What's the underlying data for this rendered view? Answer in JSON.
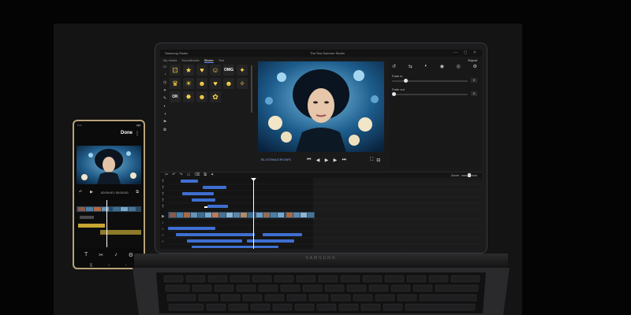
{
  "phone": {
    "status_time": "9:41",
    "status_icons": "▮▮▮",
    "done_label": "Done",
    "more_icon": "⋮",
    "play_icon": "▶",
    "timecode": "00:00:00 / 00:00:00",
    "undo_icon": "↶",
    "compare_icon": "⧉",
    "tabbar": [
      "T",
      "✂",
      "♪",
      "⚙"
    ],
    "navbar": [
      "|||",
      "○",
      "‹"
    ]
  },
  "laptop": {
    "app_title": "Samsung Studio",
    "project_title": "The Sea Summer Studio",
    "window_buttons": "— ▢ ✕",
    "tabs": [
      {
        "label": "My media",
        "active": false
      },
      {
        "label": "Soundtracks",
        "active": false
      },
      {
        "label": "Sticker",
        "active": true
      },
      {
        "label": "Text",
        "active": false
      }
    ],
    "tool_rail": [
      "▭",
      "◔",
      "◷",
      "✦",
      "✎",
      "◐",
      "◑",
      "⚑",
      "✿"
    ],
    "stickers": [
      {
        "glyph": "⊡",
        "text": false
      },
      {
        "glyph": "★",
        "text": false
      },
      {
        "glyph": "♥",
        "text": false
      },
      {
        "glyph": "☺",
        "text": false
      },
      {
        "glyph": "OMG",
        "text": true
      },
      {
        "glyph": "✦",
        "text": false
      },
      {
        "glyph": "♛",
        "text": false
      },
      {
        "glyph": "☀",
        "text": false
      },
      {
        "glyph": "☻",
        "text": false
      },
      {
        "glyph": "♥",
        "text": false
      },
      {
        "glyph": "☻",
        "text": false
      },
      {
        "glyph": "✧",
        "text": false
      },
      {
        "glyph": "OK",
        "text": true
      },
      {
        "glyph": "✸",
        "text": false
      },
      {
        "glyph": "☻",
        "text": false
      },
      {
        "glyph": "✿",
        "text": false
      }
    ],
    "preview_overlay_text": "BLOOM&GROWS",
    "preview_controls": [
      "⏮",
      "◀",
      "▶",
      "▶",
      "⏭"
    ],
    "preview_right": [
      "⛶",
      "⊟"
    ],
    "export_label": "Export",
    "props_icons": [
      "↺",
      "⇆",
      "◐",
      "◉",
      "◎",
      "⚙"
    ],
    "props": [
      {
        "label": "Fade in",
        "value": 0.18,
        "box": "0"
      },
      {
        "label": "Fade out",
        "value": 0.02,
        "box": "0"
      }
    ],
    "timeline_tools": [
      "✂",
      "↶",
      "↷",
      "▭",
      "⌫",
      "⧉",
      "✦"
    ],
    "timeline_zoom_label": "Zoom",
    "timeline_zoom": 0.5,
    "brand": "SAMSUNG"
  },
  "colors": {
    "accent": "#5b8cff",
    "clip_blue": "#3f6fd1",
    "clip_yellow": "#c9a632",
    "phone_frame": "#b9a37a"
  }
}
